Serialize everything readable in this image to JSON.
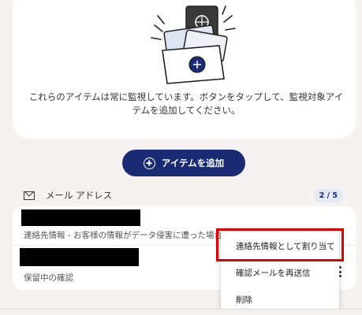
{
  "hero": {
    "description": "これらのアイテムは常に監視しています。ボタンをタップして、監視対象アイテムを追加してください。"
  },
  "add_button": {
    "label": "アイテムを追加",
    "icon": "plus-circle-icon"
  },
  "section": {
    "icon": "mail-icon",
    "title": "メール アドレス",
    "count": "2 / 5"
  },
  "items": [
    {
      "detail": "連絡先情報 - お客様の情報がデータ侵害に遭った場合、["
    },
    {
      "detail": "保留中の確認"
    }
  ],
  "menu": {
    "items": [
      {
        "label": "連絡先情報として割り当て"
      },
      {
        "label": "確認メールを再送信"
      },
      {
        "label": "削除"
      }
    ]
  },
  "colors": {
    "accent": "#1a2b73",
    "background": "#f6f2f1",
    "highlight": "#e00000"
  }
}
